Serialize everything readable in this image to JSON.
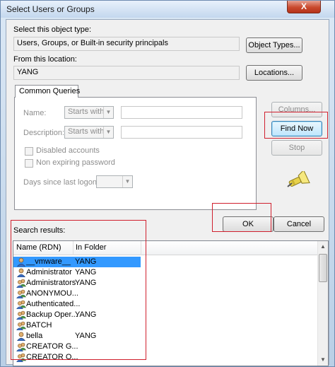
{
  "window": {
    "title": "Select Users or Groups",
    "close_glyph": "X"
  },
  "object_type": {
    "label": "Select this object type:",
    "value": "Users, Groups, or Built-in security principals",
    "button": "Object Types..."
  },
  "location": {
    "label": "From this location:",
    "value": "YANG",
    "button": "Locations..."
  },
  "common_queries": {
    "tab_label": "Common Queries",
    "name_label": "Name:",
    "name_match": "Starts with",
    "description_label": "Description:",
    "description_match": "Starts with",
    "disabled_accounts": "Disabled accounts",
    "non_expiring_password": "Non expiring password",
    "days_since_logon_label": "Days since last logon:"
  },
  "buttons": {
    "columns": "Columns...",
    "find_now": "Find Now",
    "stop": "Stop",
    "ok": "OK",
    "cancel": "Cancel"
  },
  "results": {
    "label": "Search results:",
    "columns": [
      "Name (RDN)",
      "In Folder"
    ],
    "rows": [
      {
        "name": "__vmware__",
        "folder": "YANG",
        "icon": "user-icon",
        "selected": true
      },
      {
        "name": "Administrator",
        "folder": "YANG",
        "icon": "user-icon",
        "selected": false
      },
      {
        "name": "Administrators",
        "folder": "YANG",
        "icon": "group-icon",
        "selected": false
      },
      {
        "name": "ANONYMOU...",
        "folder": "",
        "icon": "group-icon",
        "selected": false
      },
      {
        "name": "Authenticated...",
        "folder": "",
        "icon": "group-icon",
        "selected": false
      },
      {
        "name": "Backup Oper...",
        "folder": "YANG",
        "icon": "group-icon",
        "selected": false
      },
      {
        "name": "BATCH",
        "folder": "",
        "icon": "group-icon",
        "selected": false
      },
      {
        "name": "bella",
        "folder": "YANG",
        "icon": "user-icon",
        "selected": false
      },
      {
        "name": "CREATOR G...",
        "folder": "",
        "icon": "group-icon",
        "selected": false
      },
      {
        "name": "CREATOR O...",
        "folder": "",
        "icon": "group-icon",
        "selected": false
      }
    ]
  },
  "colors": {
    "highlight_box": "#d0202e",
    "selection": "#3399ff"
  }
}
